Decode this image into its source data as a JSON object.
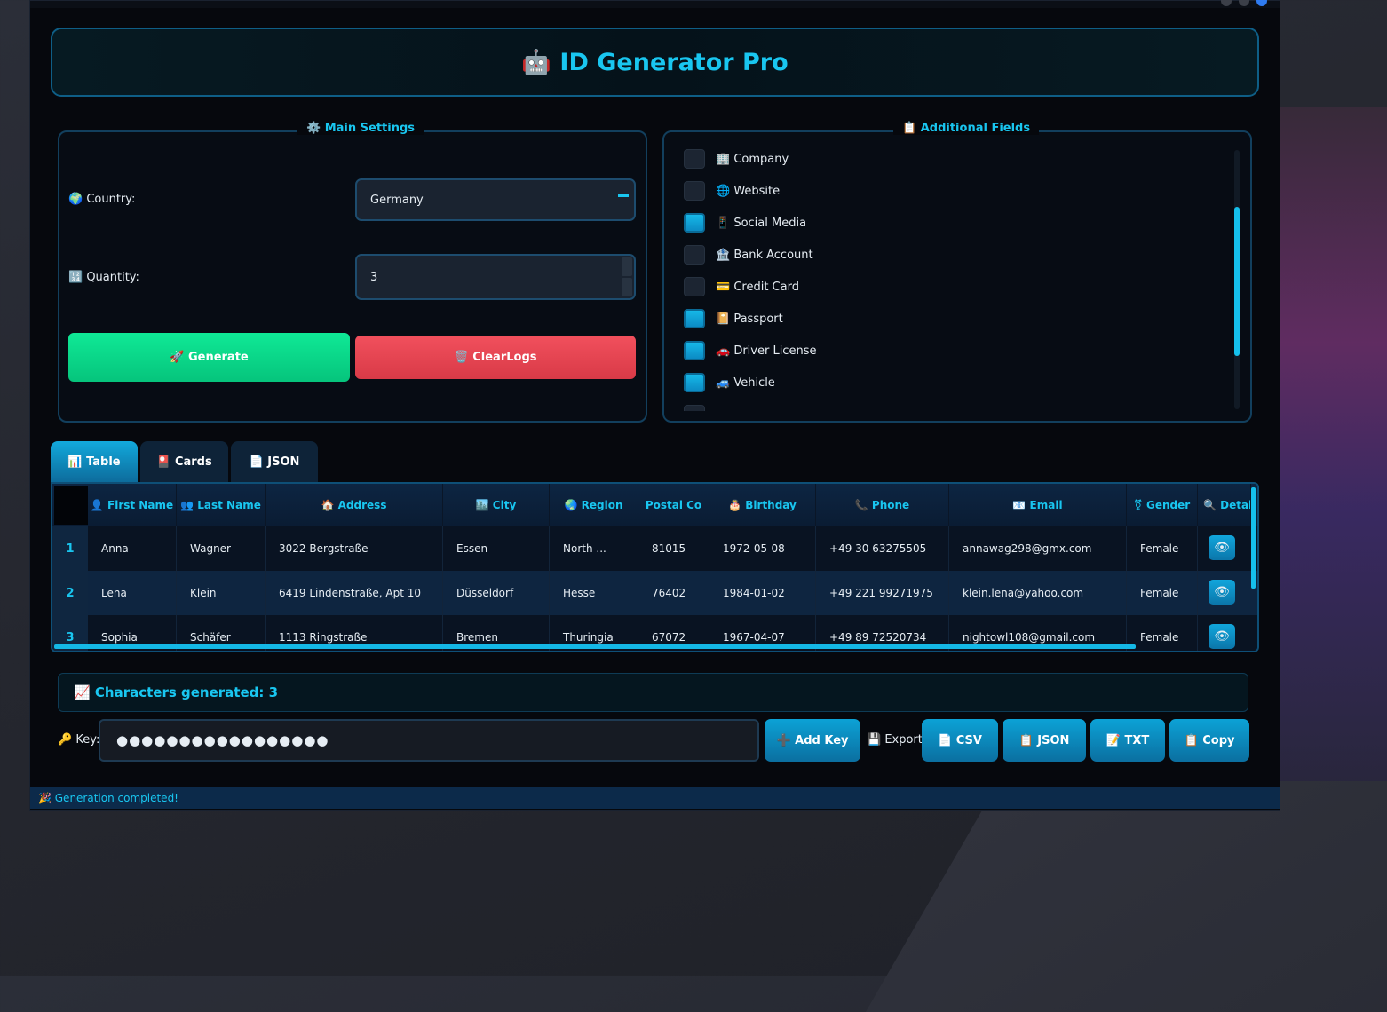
{
  "app": {
    "title": "🤖 ID Generator Pro"
  },
  "main_settings": {
    "title": "⚙️ Main Settings",
    "country_label": "🌍 Country:",
    "country_value": "Germany",
    "quantity_label": "🔢 Quantity:",
    "quantity_value": "3",
    "generate_label": "🚀 Generate",
    "clear_label": "🗑️ ClearLogs"
  },
  "additional_fields": {
    "title": "📋 Additional Fields",
    "items": [
      {
        "label": "🏢 Company",
        "checked": false
      },
      {
        "label": "🌐 Website",
        "checked": false
      },
      {
        "label": "📱 Social Media",
        "checked": true
      },
      {
        "label": "🏦 Bank Account",
        "checked": false
      },
      {
        "label": "💳 Credit Card",
        "checked": false
      },
      {
        "label": "📔 Passport",
        "checked": true
      },
      {
        "label": "🚗 Driver License",
        "checked": true
      },
      {
        "label": "🚙 Vehicle",
        "checked": true
      }
    ]
  },
  "tabs": [
    {
      "label": "📊 Table",
      "active": true
    },
    {
      "label": "🎴 Cards",
      "active": false
    },
    {
      "label": "📄 JSON",
      "active": false
    }
  ],
  "table": {
    "headers": [
      "👤 First Name",
      "👥 Last Name",
      "🏠 Address",
      "🏙️ City",
      "🌏 Region",
      "Postal Co",
      "🎂 Birthday",
      "📞 Phone",
      "📧 Email",
      "⚧ Gender",
      "🔍 Detail"
    ],
    "rows": [
      {
        "num": "1",
        "cells": [
          "Anna",
          "Wagner",
          "3022 Bergstraße",
          "Essen",
          "North ...",
          "81015",
          "1972-05-08",
          "+49 30 63275505",
          "annawag298@gmx.com",
          "Female"
        ]
      },
      {
        "num": "2",
        "cells": [
          "Lena",
          "Klein",
          "6419 Lindenstraße, Apt 10",
          "Düsseldorf",
          "Hesse",
          "76402",
          "1984-01-02",
          "+49 221 99271975",
          "klein.lena@yahoo.com",
          "Female"
        ]
      },
      {
        "num": "3",
        "cells": [
          "Sophia",
          "Schäfer",
          "1113 Ringstraße",
          "Bremen",
          "Thuringia",
          "67072",
          "1967-04-07",
          "+49 89 72520734",
          "nightowl108@gmail.com",
          "Female"
        ]
      }
    ],
    "detail_icon": "👁"
  },
  "status": {
    "generated": "📈 Characters generated: 3"
  },
  "key": {
    "label": "🔑 Key:",
    "value": "●●●●●●●●●●●●●●●●●",
    "add_label": "➕ Add Key"
  },
  "export": {
    "label": "💾 Export:",
    "csv": "📄 CSV",
    "json": "📋 JSON",
    "txt": "📝 TXT",
    "copy": "📋 Copy"
  },
  "statusbar": {
    "message": "🎉 Generation completed!"
  },
  "colors": {
    "accent": "#19c6f0",
    "generate": "#0fe996",
    "clear": "#f1505d",
    "bg": "#06080d"
  }
}
